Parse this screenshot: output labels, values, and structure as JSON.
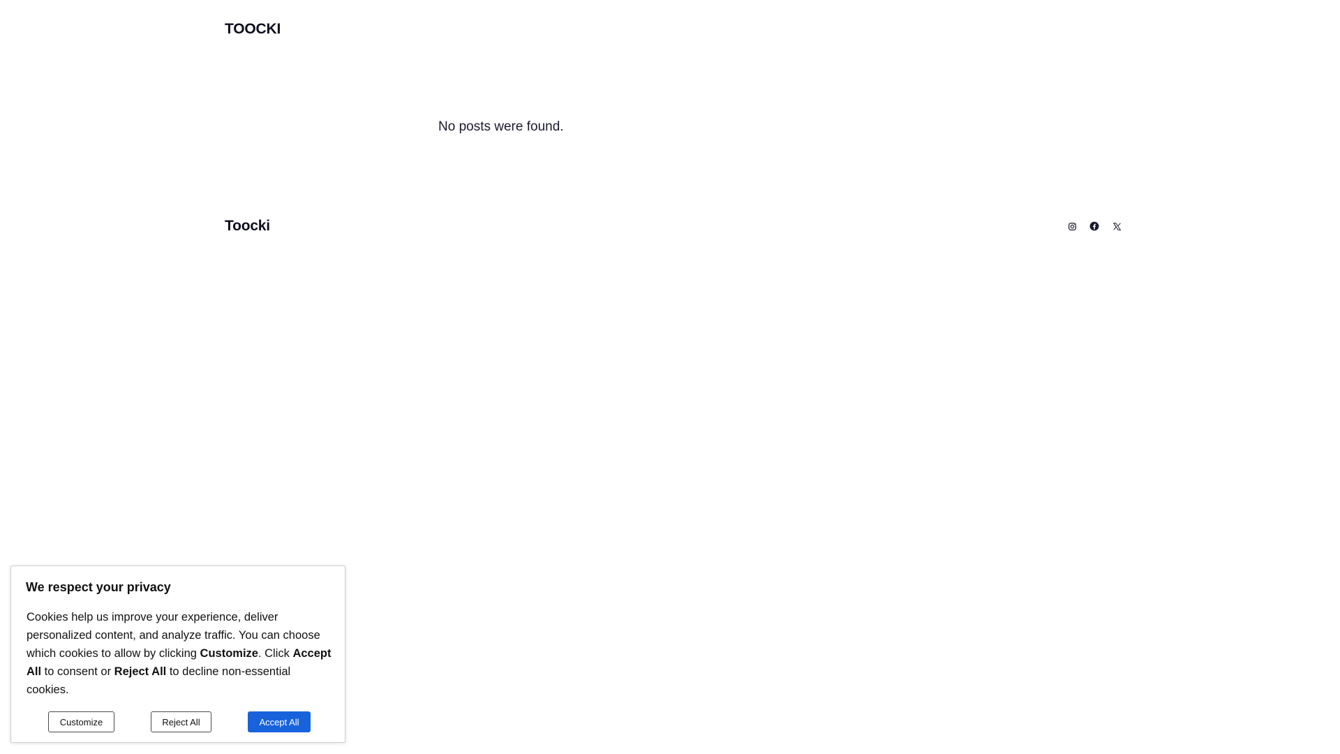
{
  "header": {
    "site_title": "TOOCKI"
  },
  "main": {
    "empty_message": "No posts were found."
  },
  "footer": {
    "site_title": "Toocki",
    "social": [
      {
        "icon": "instagram-icon"
      },
      {
        "icon": "facebook-icon"
      },
      {
        "icon": "x-icon"
      }
    ]
  },
  "cookie_banner": {
    "title": "We respect your privacy",
    "text_part1": "Cookies help us improve your experience, deliver personalized content, and analyze traffic. You can choose which cookies to allow by clicking ",
    "text_bold1": "Customize",
    "text_part2": ". Click ",
    "text_bold2": "Accept All",
    "text_part3": " to consent or ",
    "text_bold3": "Reject All",
    "text_part4": " to decline non-essential cookies.",
    "customize_label": "Customize",
    "reject_label": "Reject All",
    "accept_label": "Accept All",
    "accept_color": "#1863dc"
  }
}
